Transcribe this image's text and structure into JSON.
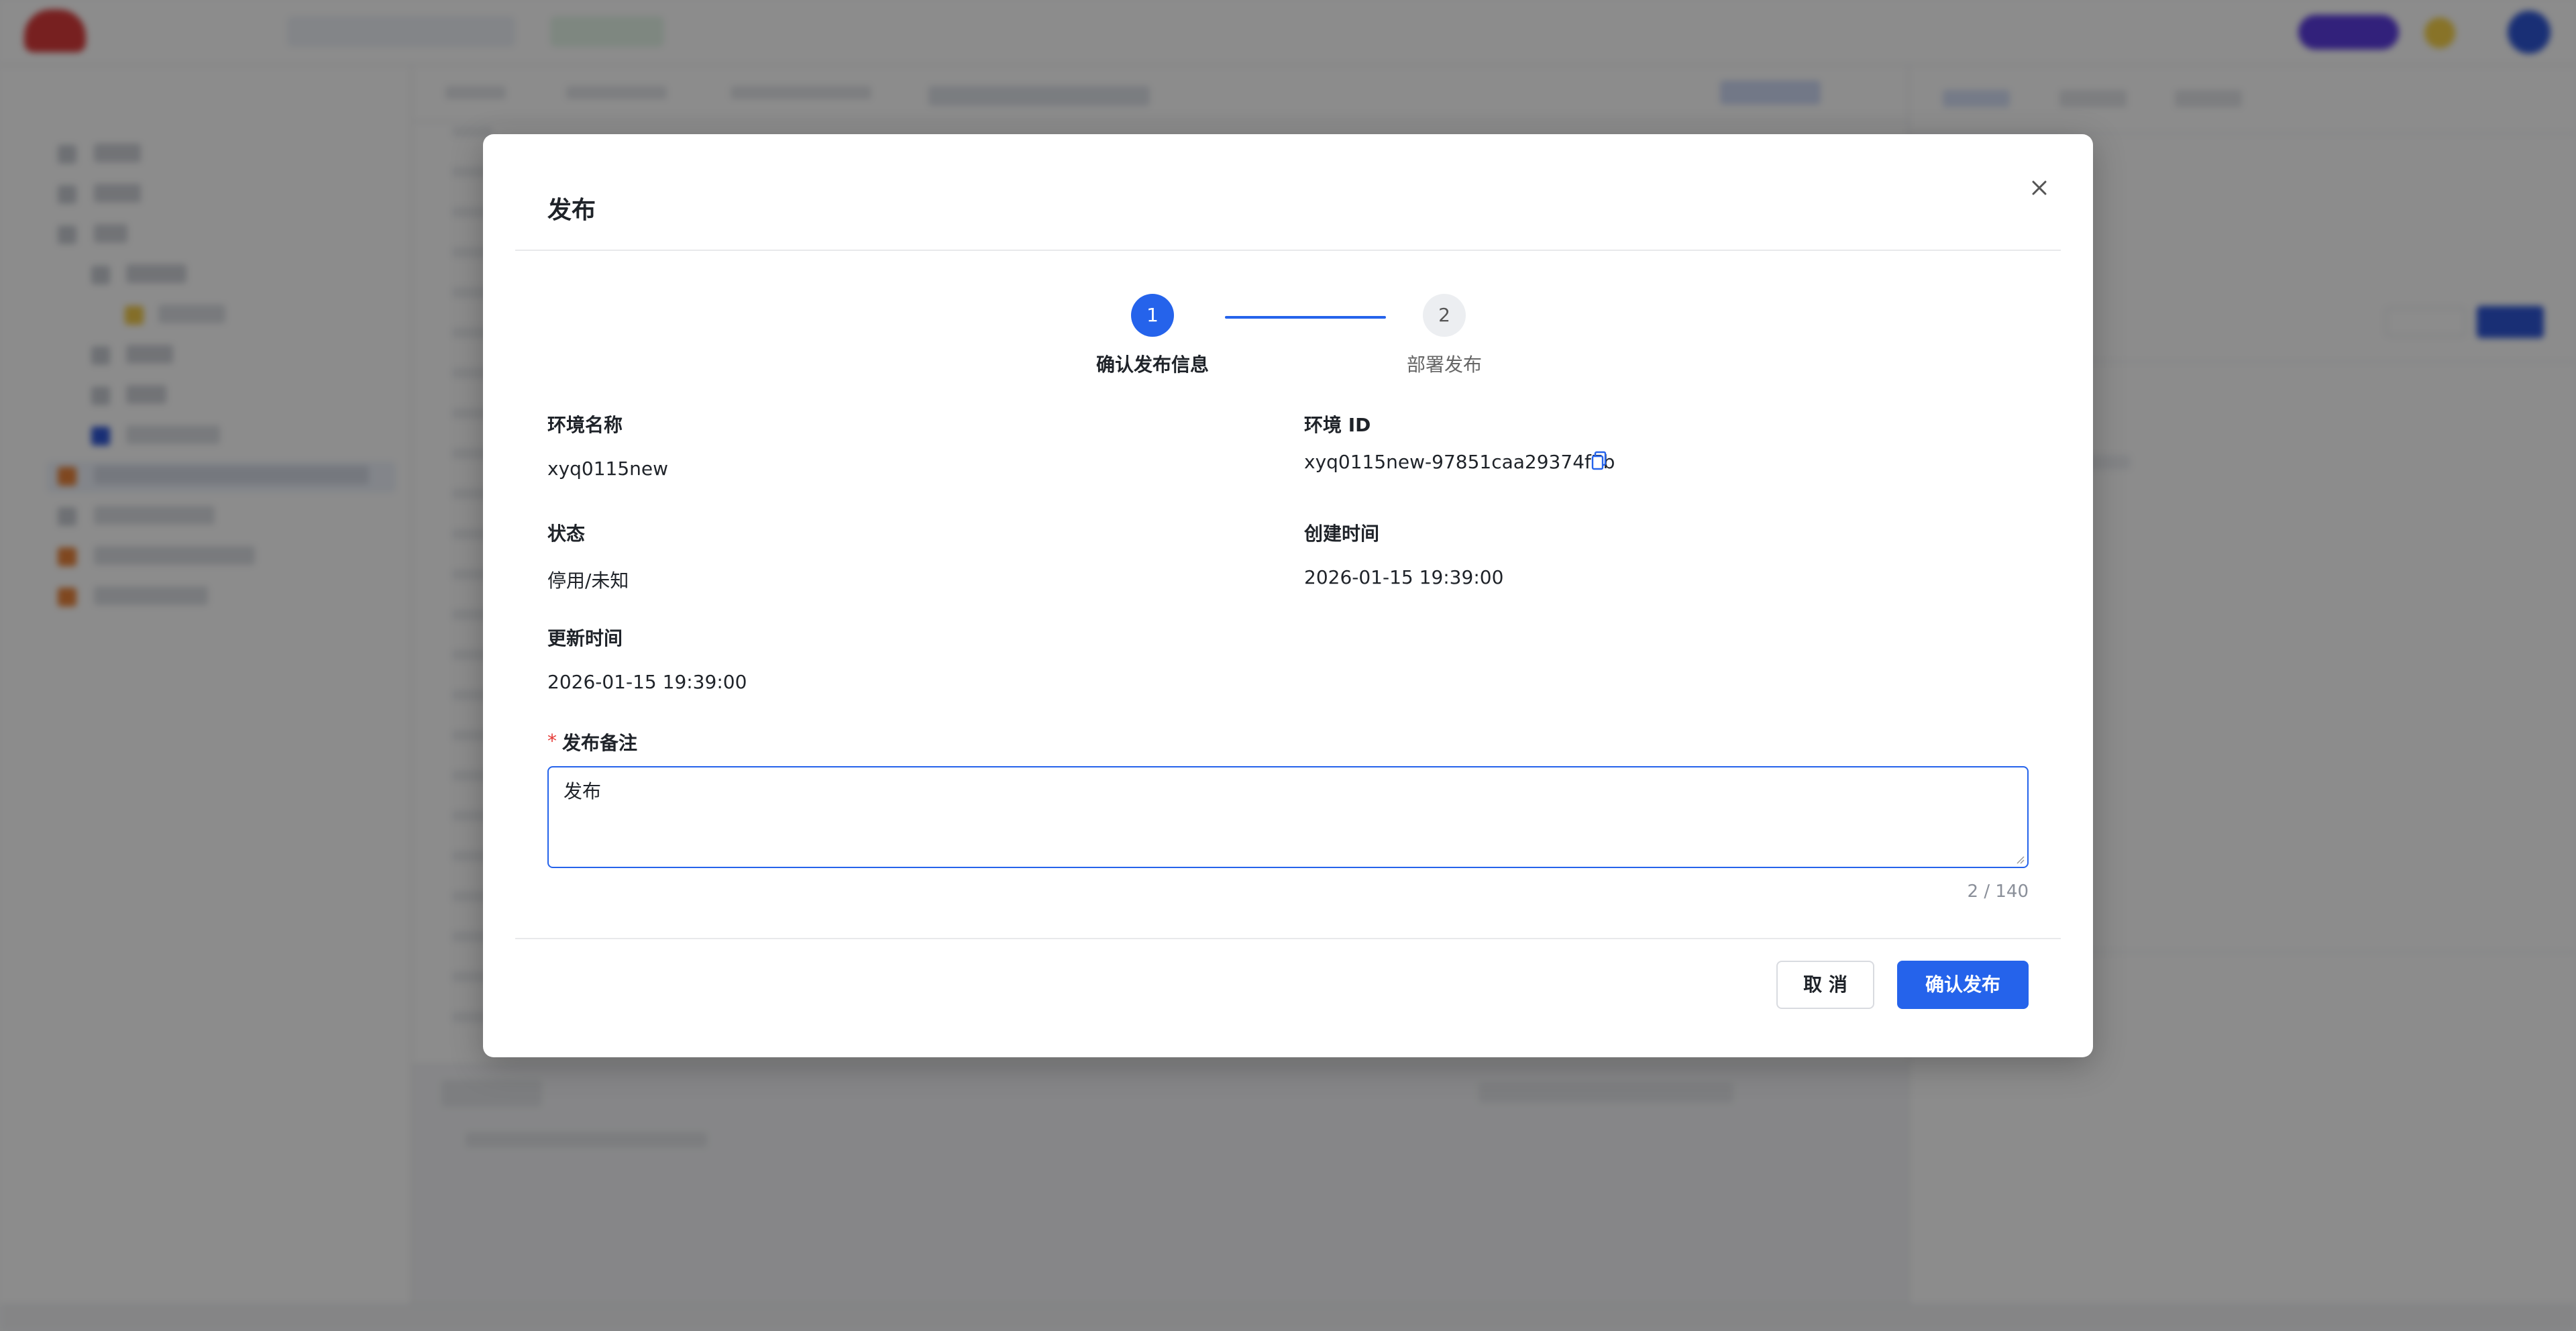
{
  "modal": {
    "title": "发布",
    "steps": [
      {
        "number": "1",
        "label": "确认发布信息",
        "state": "active"
      },
      {
        "number": "2",
        "label": "部署发布",
        "state": "pending"
      }
    ],
    "fields": {
      "env_name": {
        "label": "环境名称",
        "value": "xyq0115new"
      },
      "env_id": {
        "label": "环境 ID",
        "value": "xyq0115new-97851caa29374f7b"
      },
      "status": {
        "label": "状态",
        "value": "停用/未知"
      },
      "created_time": {
        "label": "创建时间",
        "value": "2026-01-15 19:39:00"
      },
      "updated_time": {
        "label": "更新时间",
        "value": "2026-01-15 19:39:00"
      }
    },
    "remark": {
      "required_mark": "*",
      "label": "发布备注",
      "value": "发布",
      "counter": "2 / 140"
    },
    "buttons": {
      "cancel": "取 消",
      "confirm": "确认发布"
    }
  },
  "colors": {
    "primary": "#2563eb",
    "required": "#e53935",
    "overlay": "rgba(0,0,0,0.45)"
  },
  "icons": {
    "close": "close-icon",
    "copy": "copy-icon"
  }
}
